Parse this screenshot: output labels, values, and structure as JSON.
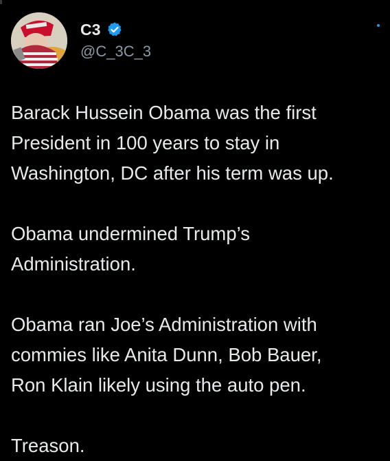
{
  "post": {
    "author": {
      "display_name": "C3",
      "handle": "@C_3C_3",
      "verified": true,
      "verified_icon": "verified-badge-icon",
      "verified_color": "#1d9bf0"
    },
    "paragraphs": [
      {
        "lines": [
          "Barack Hussein Obama was the first",
          "President in 100 years to stay in",
          "Washington, DC after his term was up."
        ]
      },
      {
        "lines": [
          "Obama undermined Trump’s",
          "Administration."
        ]
      },
      {
        "lines": [
          "Obama ran Joe’s Administration with",
          "commies like Anita Dunn, Bob Bauer,",
          "Ron Klain likely using the auto pen."
        ]
      },
      {
        "lines": [
          "Treason."
        ]
      }
    ]
  },
  "colors": {
    "background": "#000000",
    "text": "#e7e9ea",
    "secondary_text": "#8b98a5",
    "accent": "#1d9bf0"
  }
}
